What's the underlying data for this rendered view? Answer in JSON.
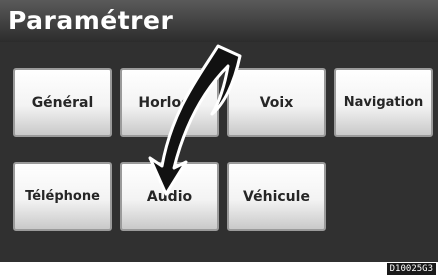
{
  "header": {
    "title": "Paramétrer"
  },
  "buttons": {
    "general": "Général",
    "horloge": "Horloge",
    "voix": "Voix",
    "navigation": "Navigation",
    "telephone": "Téléphone",
    "audio": "Audio",
    "vehicule": "Véhicule"
  },
  "footer": {
    "code": "D10025G3"
  },
  "colors": {
    "background": "#303030",
    "title_text": "#ffffff",
    "button_face": "#f3f3f3",
    "arrow": "#111111"
  }
}
